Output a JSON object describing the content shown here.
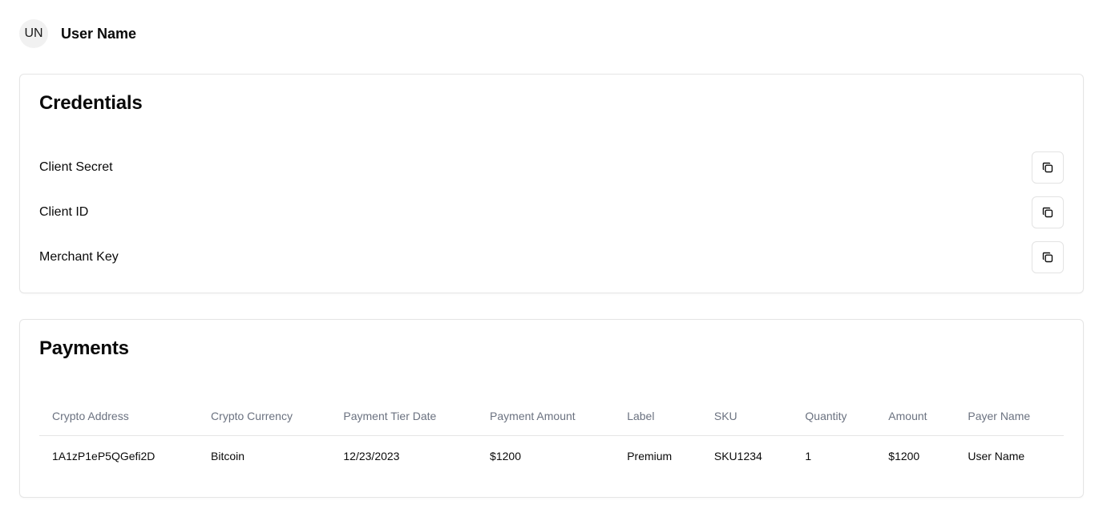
{
  "user": {
    "initials": "UN",
    "name": "User Name"
  },
  "credentials": {
    "title": "Credentials",
    "items": [
      {
        "label": "Client Secret",
        "icon": "copy-icon"
      },
      {
        "label": "Client ID",
        "icon": "copy-icon"
      },
      {
        "label": "Merchant Key",
        "icon": "copy-icon"
      }
    ]
  },
  "payments": {
    "title": "Payments",
    "columns": [
      "Crypto Address",
      "Crypto Currency",
      "Payment Tier Date",
      "Payment Amount",
      "Label",
      "SKU",
      "Quantity",
      "Amount",
      "Payer Name"
    ],
    "rows": [
      [
        "1A1zP1eP5QGefi2D",
        "Bitcoin",
        "12/23/2023",
        "$1200",
        "Premium",
        "SKU1234",
        "1",
        "$1200",
        "User Name"
      ]
    ]
  },
  "colors": {
    "border": "#e5e5e5",
    "muted_text": "#6b7280",
    "avatar_bg": "#f1f1f1"
  }
}
